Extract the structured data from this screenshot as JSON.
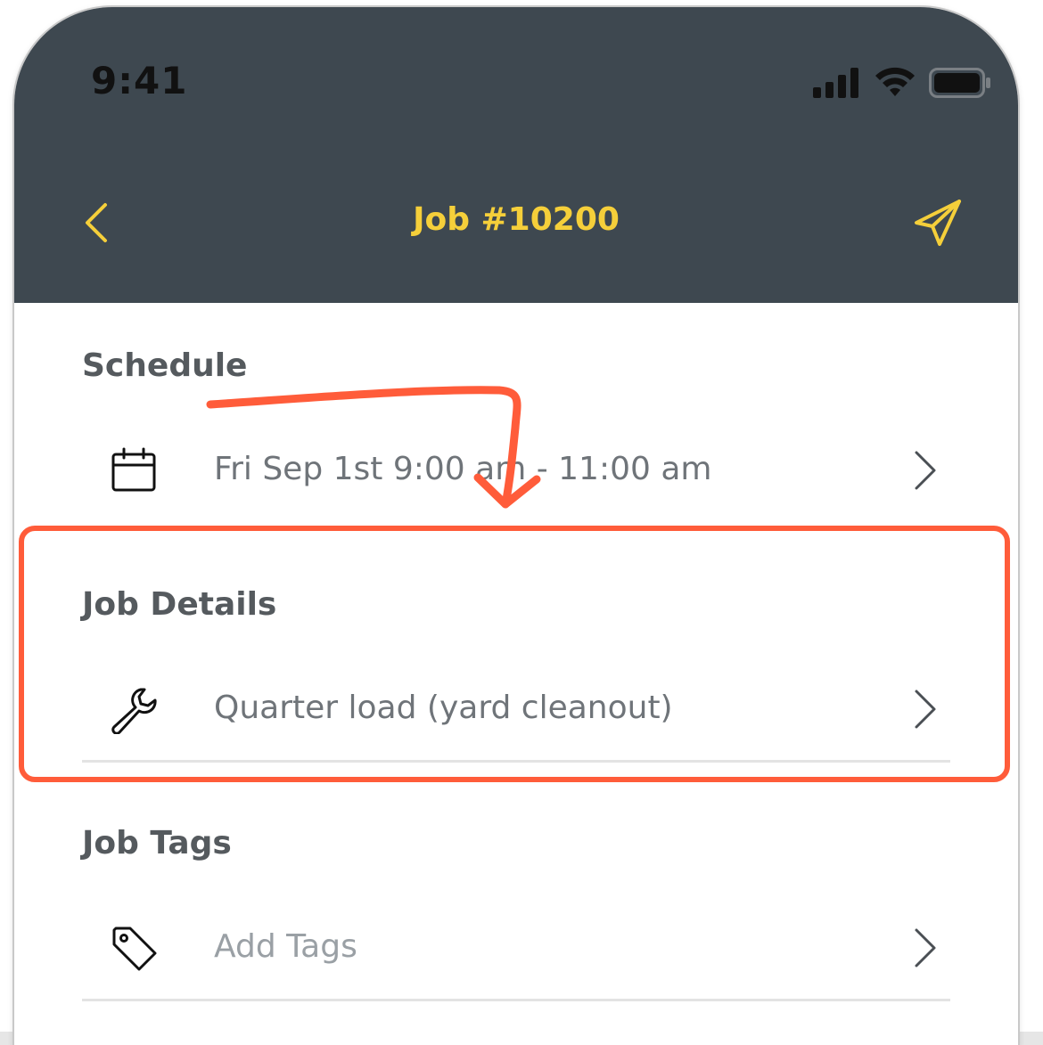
{
  "status_bar": {
    "time": "9:41"
  },
  "nav": {
    "title": "Job #10200",
    "back_icon": "chevron-left-icon",
    "send_icon": "paper-plane-icon"
  },
  "sections": {
    "schedule": {
      "title": "Schedule",
      "value": "Fri Sep 1st 9:00 am - 11:00 am",
      "icon": "calendar-icon"
    },
    "job_details": {
      "title": "Job Details",
      "value": "Quarter load (yard cleanout)",
      "icon": "wrench-icon"
    },
    "job_tags": {
      "title": "Job Tags",
      "placeholder": "Add Tags",
      "icon": "tag-icon"
    }
  },
  "colors": {
    "header_bg": "#3e4850",
    "accent": "#f5cf3a",
    "annotation": "#ff5c3a"
  }
}
